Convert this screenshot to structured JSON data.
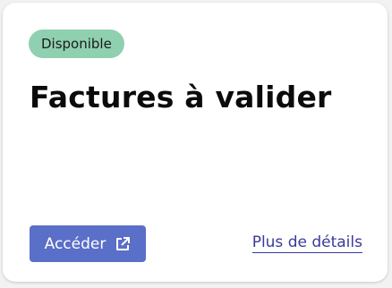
{
  "card": {
    "status_badge": "Disponible",
    "title": "Factures à valider",
    "access_button_label": "Accéder",
    "access_button_icon": "external-link-icon",
    "details_link_label": "Plus de détails",
    "colors": {
      "badge_bg": "#8fd0b0",
      "button_bg": "#5a6fc8",
      "link": "#3a3a9a"
    }
  }
}
